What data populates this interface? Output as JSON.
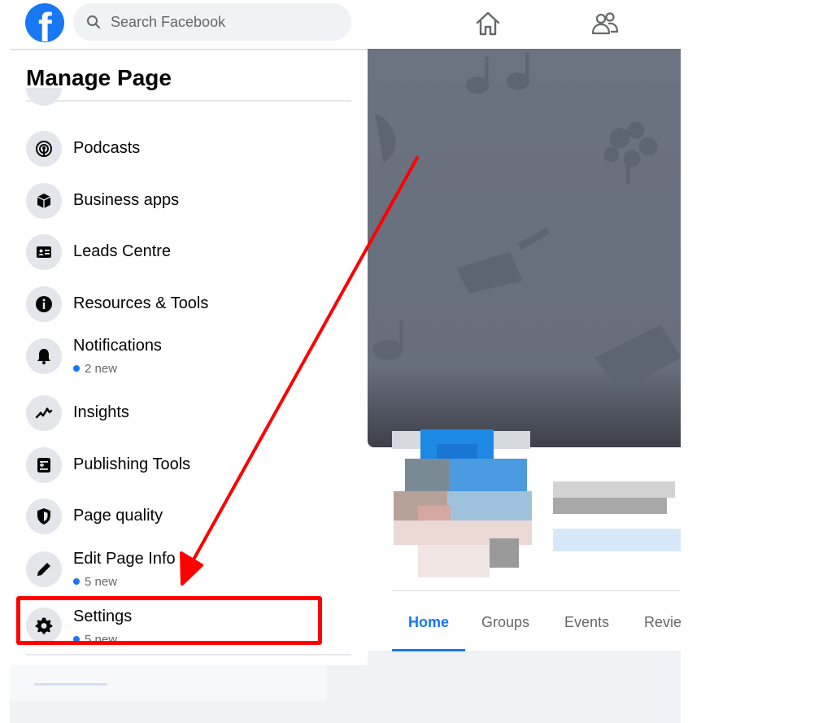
{
  "topbar": {
    "search_placeholder": "Search Facebook",
    "logo_letter": "f",
    "brand_color": "#1877f2",
    "icons": [
      "facebook-logo",
      "search-icon",
      "home-icon",
      "friends-icon"
    ]
  },
  "sidebar": {
    "title": "Manage Page",
    "items": [
      {
        "label": "Podcasts",
        "icon": "podcast-icon",
        "sub": ""
      },
      {
        "label": "Business apps",
        "icon": "cube-icon",
        "sub": ""
      },
      {
        "label": "Leads Centre",
        "icon": "id-card-icon",
        "sub": ""
      },
      {
        "label": "Resources & Tools",
        "icon": "info-icon",
        "sub": ""
      },
      {
        "label": "Notifications",
        "icon": "bell-icon",
        "sub": "2 new"
      },
      {
        "label": "Insights",
        "icon": "trend-line-icon",
        "sub": ""
      },
      {
        "label": "Publishing Tools",
        "icon": "publishing-icon",
        "sub": ""
      },
      {
        "label": "Page quality",
        "icon": "shield-icon",
        "sub": ""
      },
      {
        "label": "Edit Page Info",
        "icon": "pencil-icon",
        "sub": "5 new"
      },
      {
        "label": "Settings",
        "icon": "gear-icon",
        "sub": "5 new"
      }
    ]
  },
  "tabs": [
    {
      "label": "Home",
      "active": true
    },
    {
      "label": "Groups",
      "active": false
    },
    {
      "label": "Events",
      "active": false
    },
    {
      "label": "Revie",
      "active": false
    }
  ],
  "annotation": {
    "color": "#ff0000",
    "target": "Settings"
  }
}
